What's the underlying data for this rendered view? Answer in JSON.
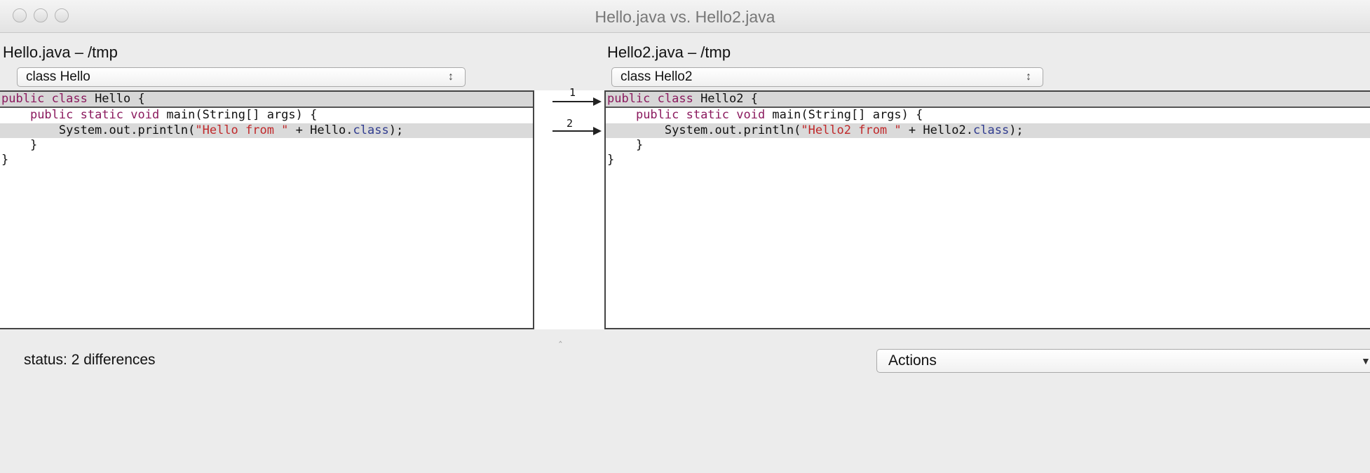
{
  "window": {
    "title": "Hello.java vs. Hello2.java"
  },
  "left": {
    "file_label": "Hello.java – /tmp",
    "selector": "class Hello",
    "lines": [
      [
        [
          "kw",
          "public class "
        ],
        [
          "",
          "Hello {"
        ]
      ],
      [
        [
          "",
          "    "
        ],
        [
          "kw",
          "public static void "
        ],
        [
          "",
          "main(String[] args) {"
        ]
      ],
      [
        [
          "",
          "        System.out.println("
        ],
        [
          "str",
          "\"Hello from \""
        ],
        [
          "",
          " + Hello."
        ],
        [
          "fld",
          "class"
        ],
        [
          "",
          ");"
        ]
      ],
      [
        [
          "",
          "    }"
        ]
      ],
      [
        [
          "",
          "}"
        ]
      ]
    ]
  },
  "right": {
    "file_label": "Hello2.java – /tmp",
    "selector": "class Hello2",
    "lines": [
      [
        [
          "kw",
          "public class "
        ],
        [
          "",
          "Hello2 {"
        ]
      ],
      [
        [
          "",
          "    "
        ],
        [
          "kw",
          "public static void "
        ],
        [
          "",
          "main(String[] args) {"
        ]
      ],
      [
        [
          "",
          "        System.out.println("
        ],
        [
          "str",
          "\"Hello2 from \""
        ],
        [
          "",
          " + Hello2."
        ],
        [
          "fld",
          "class"
        ],
        [
          "",
          ");"
        ]
      ],
      [
        [
          "",
          "    }"
        ]
      ],
      [
        [
          "",
          "}"
        ]
      ]
    ]
  },
  "gutter": {
    "diff_numbers": [
      "1",
      "2"
    ]
  },
  "footer": {
    "status": "status: 2 differences",
    "actions_label": "Actions"
  },
  "colors": {
    "keyword": "#8b1a5e",
    "string": "#c0282a",
    "field": "#2f3b8f",
    "diff_bg": "#d7d7d7"
  }
}
